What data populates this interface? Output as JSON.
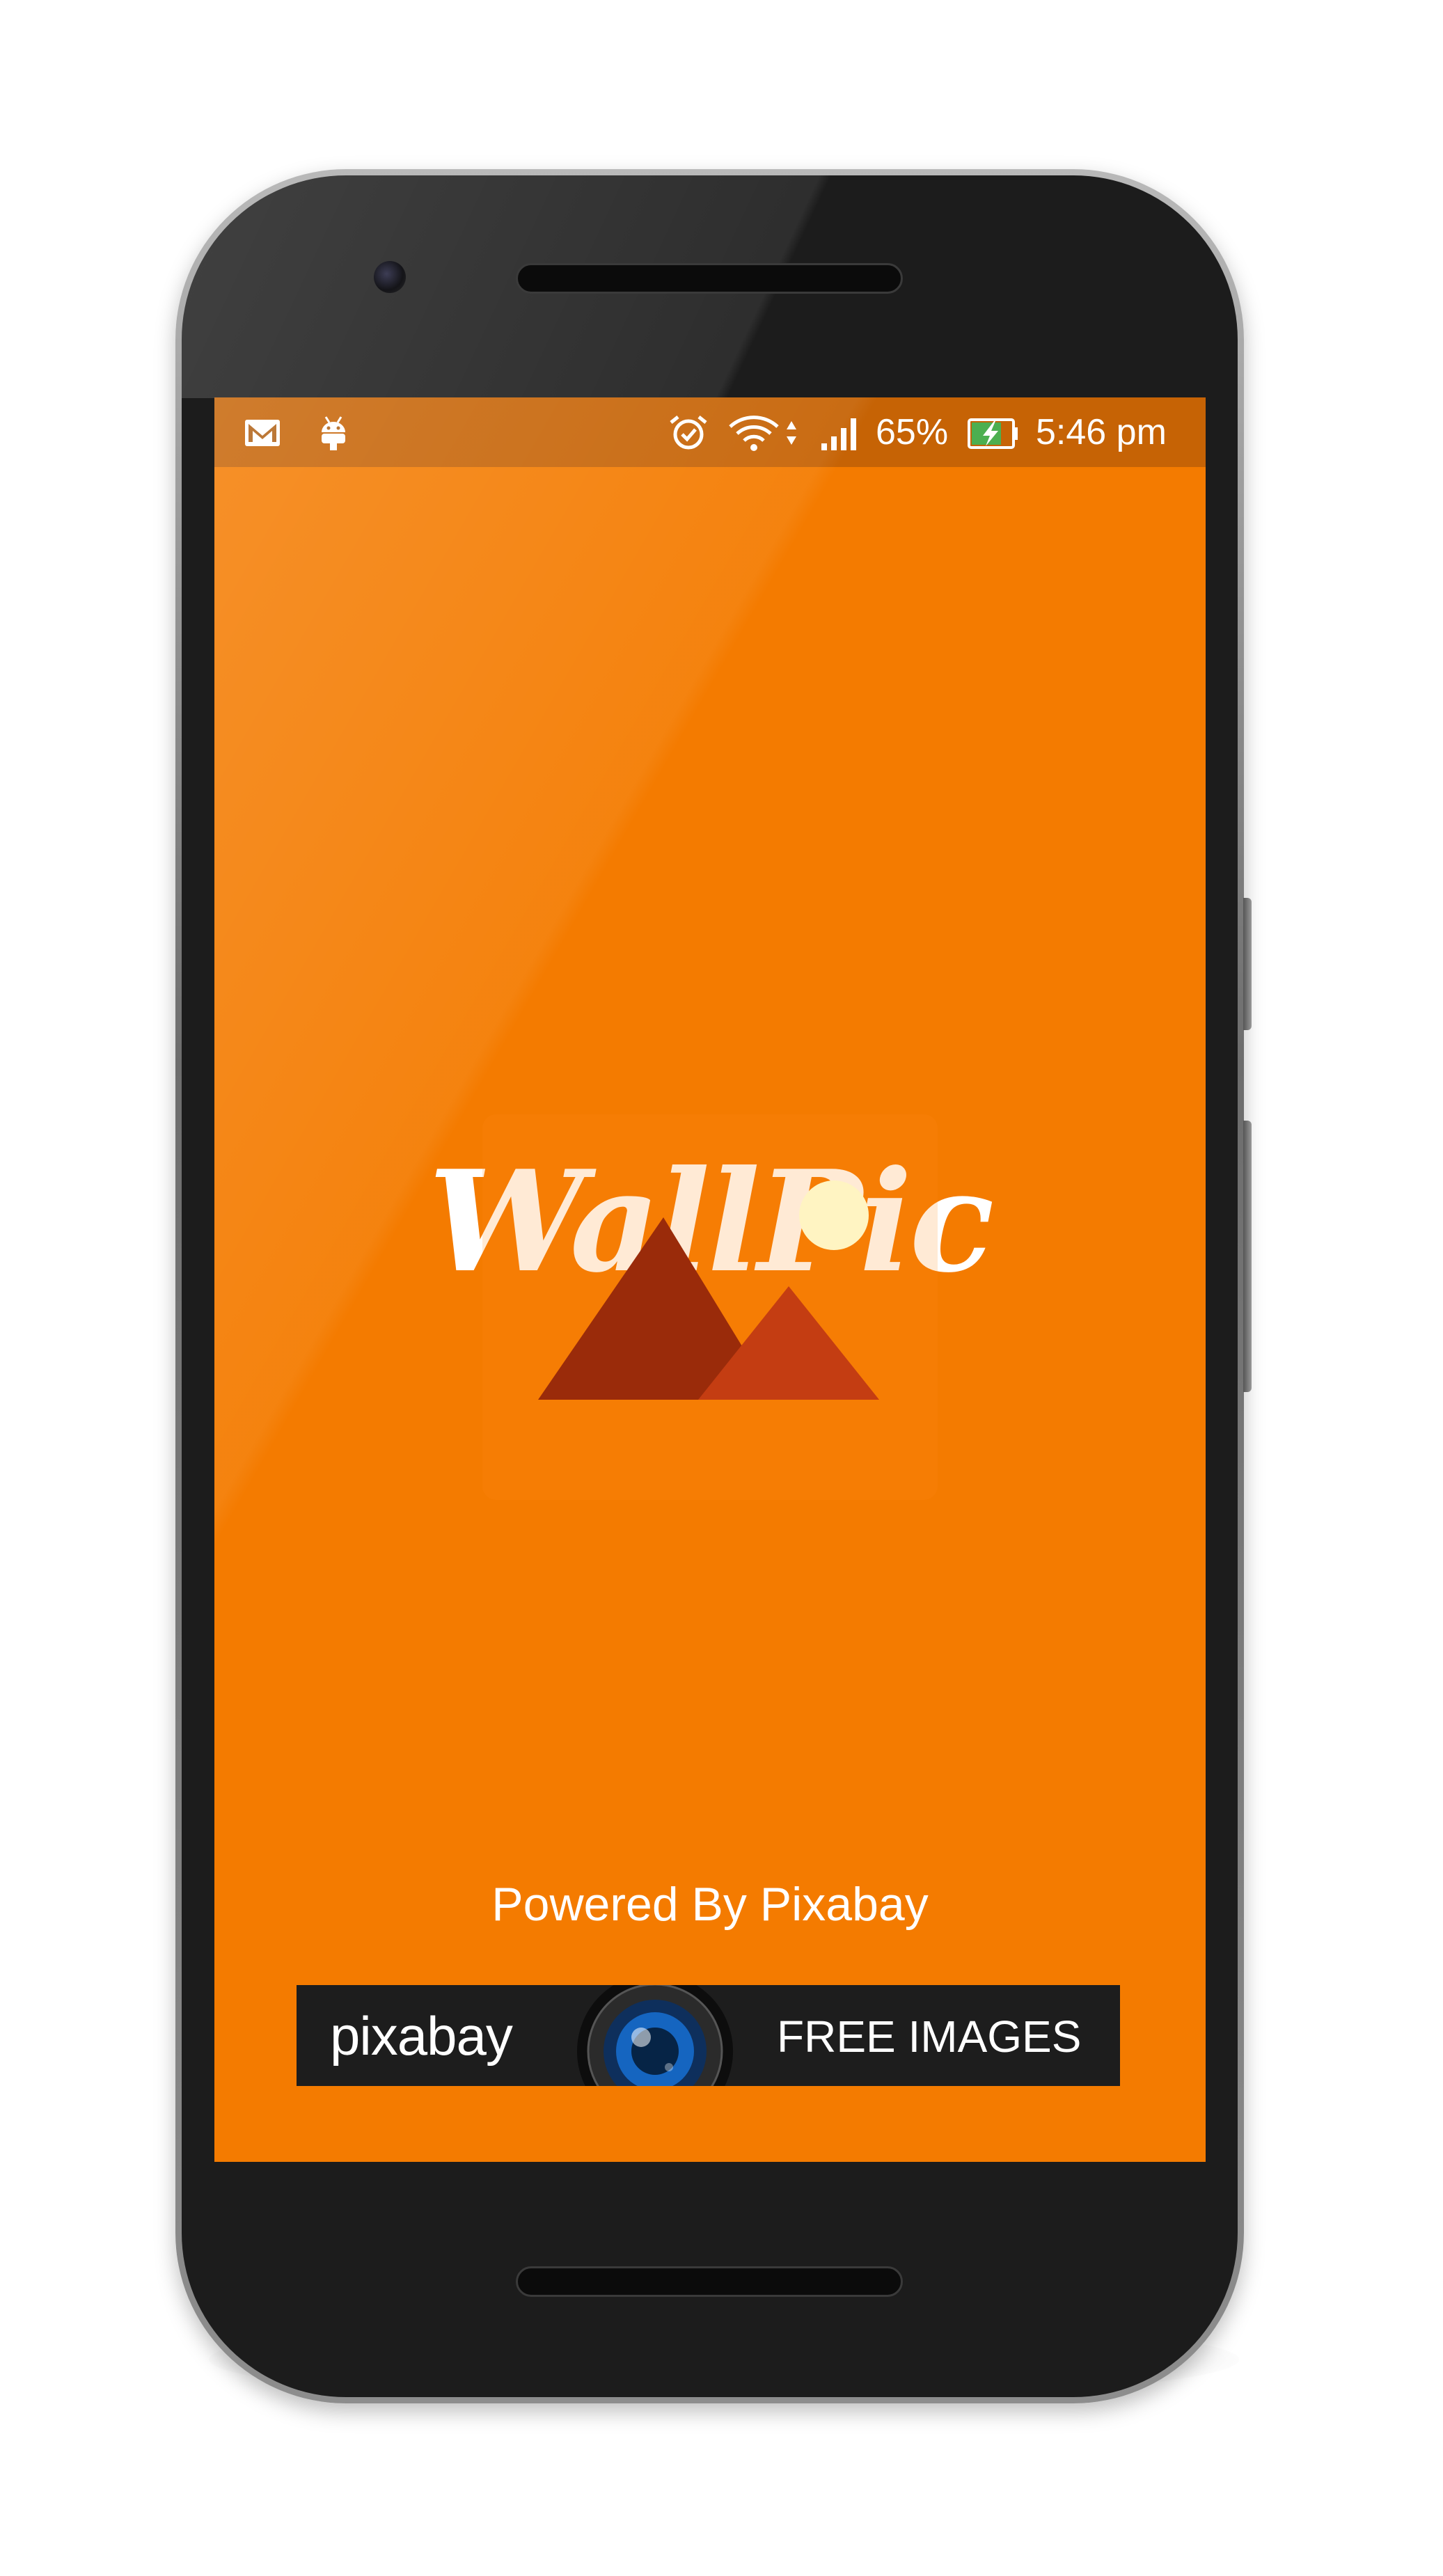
{
  "status_bar": {
    "notification_icons": [
      "gmail-icon",
      "android-debug-icon"
    ],
    "system_icons": [
      "alarm-icon",
      "wifi-icon",
      "data-arrows-icon",
      "signal-icon",
      "battery-charging-icon"
    ],
    "battery_percent": "65%",
    "time": "5:46 pm"
  },
  "app": {
    "title": "WallPic",
    "placeholder_icon": "image-placeholder-icon",
    "powered_by": "Powered By Pixabay"
  },
  "banner": {
    "logo": "pixabay",
    "tagline": "FREE IMAGES",
    "lens_icon": "camera-lens-icon"
  },
  "colors": {
    "accent": "#f47b00",
    "mountain_dark": "#9a2b0a",
    "mountain_light": "#c43d12",
    "sun": "#fff4c2",
    "banner_bg": "#1d1d1d"
  }
}
